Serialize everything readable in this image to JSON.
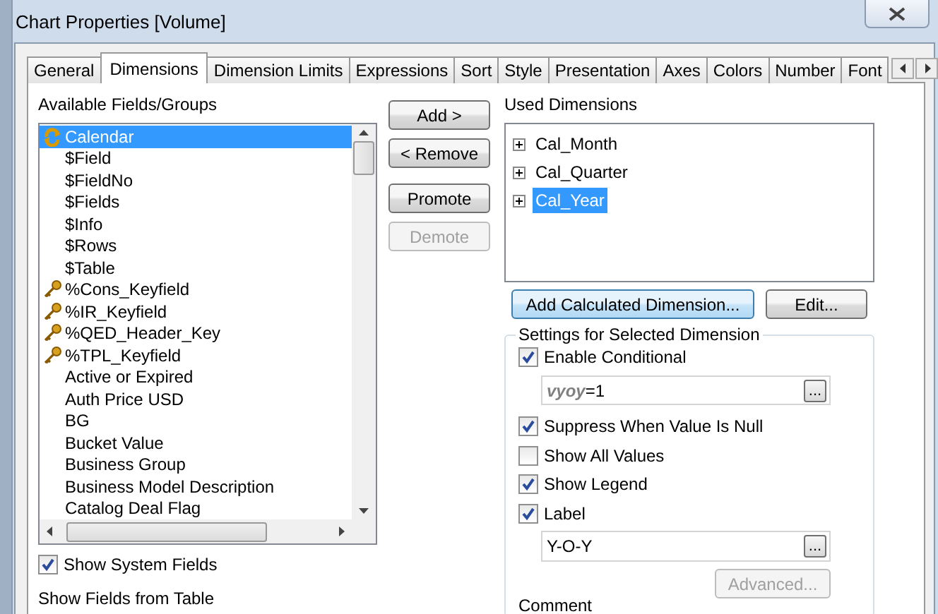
{
  "window": {
    "title": "Chart Properties [Volume]"
  },
  "tabs": [
    {
      "label": "General",
      "selected": false
    },
    {
      "label": "Dimensions",
      "selected": true
    },
    {
      "label": "Dimension Limits",
      "selected": false
    },
    {
      "label": "Expressions",
      "selected": false
    },
    {
      "label": "Sort",
      "selected": false
    },
    {
      "label": "Style",
      "selected": false
    },
    {
      "label": "Presentation",
      "selected": false
    },
    {
      "label": "Axes",
      "selected": false
    },
    {
      "label": "Colors",
      "selected": false
    },
    {
      "label": "Number",
      "selected": false
    },
    {
      "label": "Font",
      "selected": false
    }
  ],
  "available": {
    "label": "Available Fields/Groups",
    "items": [
      {
        "label": "Calendar",
        "kind": "group",
        "selected": true
      },
      {
        "label": "$Field",
        "kind": "field",
        "selected": false
      },
      {
        "label": "$FieldNo",
        "kind": "field",
        "selected": false
      },
      {
        "label": "$Fields",
        "kind": "field",
        "selected": false
      },
      {
        "label": "$Info",
        "kind": "field",
        "selected": false
      },
      {
        "label": "$Rows",
        "kind": "field",
        "selected": false
      },
      {
        "label": "$Table",
        "kind": "field",
        "selected": false
      },
      {
        "label": "%Cons_Keyfield",
        "kind": "key",
        "selected": false
      },
      {
        "label": "%IR_Keyfield",
        "kind": "key",
        "selected": false
      },
      {
        "label": "%QED_Header_Key",
        "kind": "key",
        "selected": false
      },
      {
        "label": "%TPL_Keyfield",
        "kind": "key",
        "selected": false
      },
      {
        "label": "Active or Expired",
        "kind": "field",
        "selected": false
      },
      {
        "label": "Auth Price USD",
        "kind": "field",
        "selected": false
      },
      {
        "label": "BG",
        "kind": "field",
        "selected": false
      },
      {
        "label": "Bucket Value",
        "kind": "field",
        "selected": false
      },
      {
        "label": "Business Group",
        "kind": "field",
        "selected": false
      },
      {
        "label": "Business Model Description",
        "kind": "field",
        "selected": false
      },
      {
        "label": "Catalog Deal Flag",
        "kind": "field",
        "selected": false
      }
    ],
    "show_system_fields": {
      "label": "Show System Fields",
      "checked": true
    },
    "show_fields_from_table": "Show Fields from Table"
  },
  "middle_buttons": [
    {
      "label": "Add >",
      "disabled": false
    },
    {
      "label": "< Remove",
      "disabled": false
    },
    {
      "label": "Promote",
      "disabled": false
    },
    {
      "label": "Demote",
      "disabled": true
    }
  ],
  "used": {
    "label": "Used Dimensions",
    "items": [
      {
        "label": "Cal_Month",
        "expanded": false,
        "selected": false
      },
      {
        "label": "Cal_Quarter",
        "expanded": false,
        "selected": false
      },
      {
        "label": "Cal_Year",
        "expanded": false,
        "selected": true
      }
    ],
    "buttons": [
      {
        "label": "Add Calculated Dimension...",
        "focused": true
      },
      {
        "label": "Edit...",
        "focused": false
      }
    ]
  },
  "settings": {
    "title": "Settings for Selected Dimension",
    "rows": [
      {
        "kind": "check",
        "label": "Enable Conditional",
        "checked": true
      },
      {
        "kind": "field",
        "value": "*vyoy*=1",
        "button": "..."
      },
      {
        "kind": "check",
        "label": "Suppress When Value Is Null",
        "checked": true
      },
      {
        "kind": "check",
        "label": "Show All Values",
        "checked": false
      },
      {
        "kind": "check",
        "label": "Show Legend",
        "checked": true
      },
      {
        "kind": "check",
        "label": "Label",
        "checked": true
      },
      {
        "kind": "field",
        "value": "Y-O-Y",
        "button": "..."
      }
    ],
    "advanced": {
      "label": "Advanced...",
      "disabled": true
    },
    "comment": "Comment"
  }
}
